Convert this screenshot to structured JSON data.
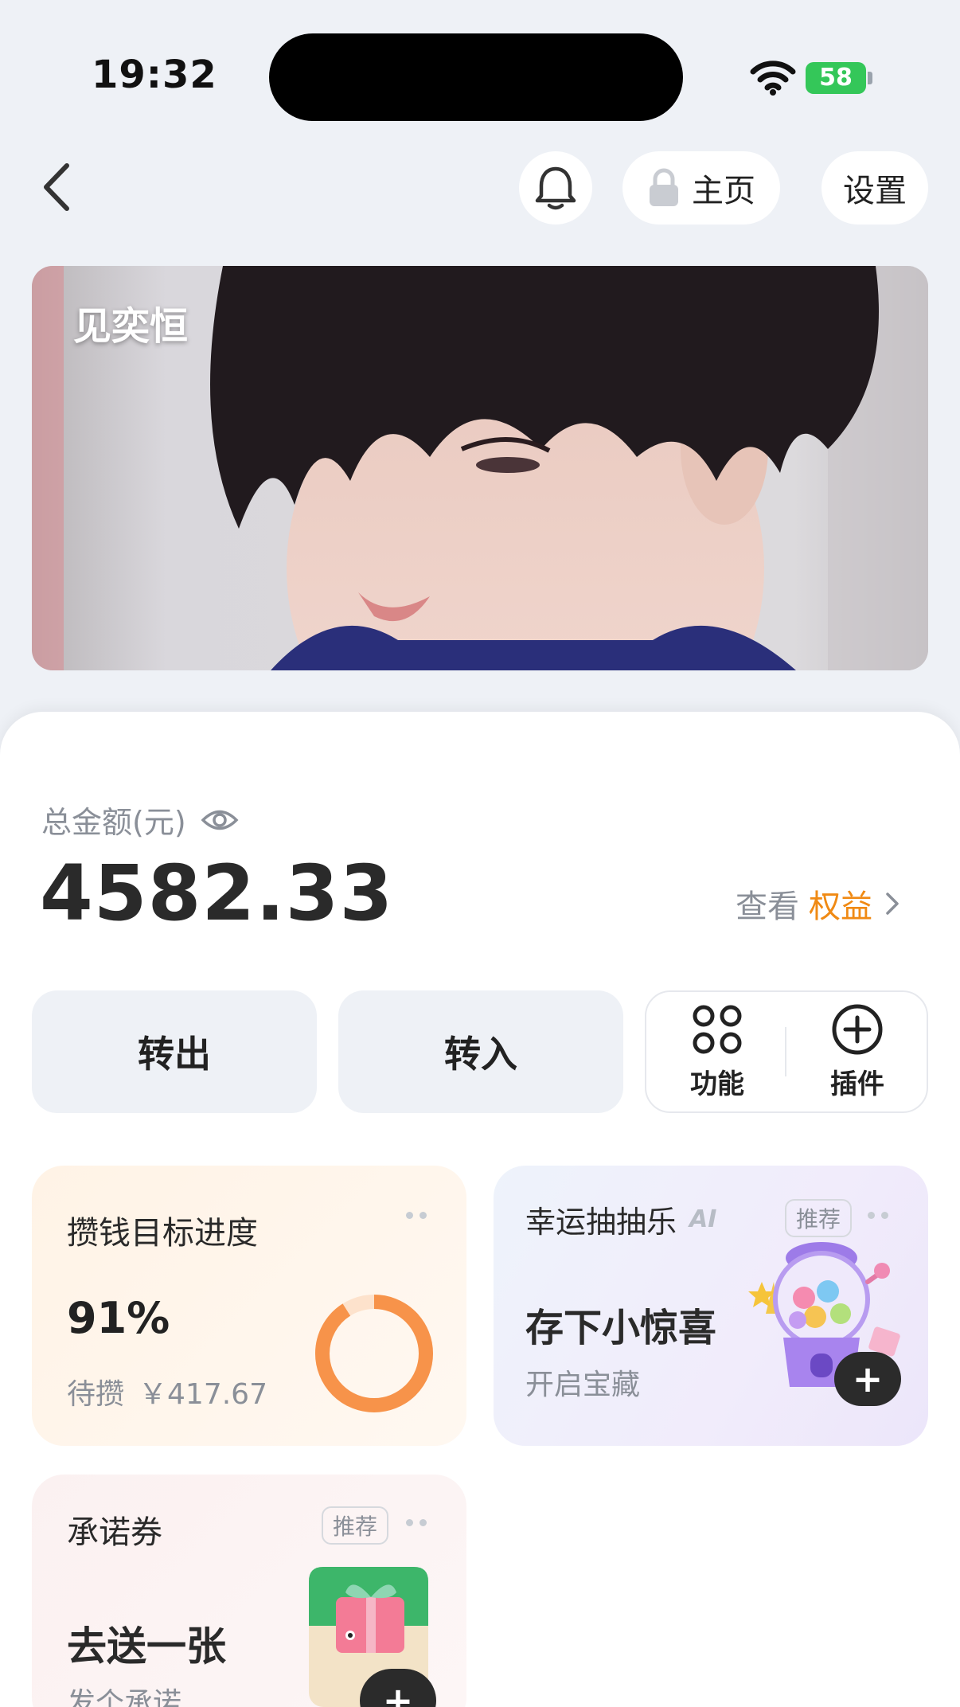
{
  "status_bar": {
    "time": "19:32",
    "battery": "58"
  },
  "nav": {
    "home_label": "主页",
    "settings_label": "设置"
  },
  "banner": {
    "title": "见奕恒"
  },
  "balance": {
    "label": "总金额(元)",
    "amount": "4582.33",
    "rights_prefix": "查看",
    "rights_accent": "权益"
  },
  "actions": {
    "transfer_out": "转出",
    "transfer_in": "转入",
    "functions": "功能",
    "plugins": "插件"
  },
  "goal_card": {
    "title": "攒钱目标进度",
    "percent": "91%",
    "progress": 0.91,
    "pending_label": "待攒",
    "pending_amount": "￥417.67"
  },
  "lucky_card": {
    "title": "幸运抽抽乐",
    "ai_badge": "AI",
    "tag": "推荐",
    "headline": "存下小惊喜",
    "sub": "开启宝藏"
  },
  "promise_card": {
    "title": "承诺券",
    "tag": "推荐",
    "headline": "去送一张",
    "sub": "发个承诺"
  },
  "colors": {
    "accent_orange": "#f08a14",
    "ring_orange": "#f7934a",
    "battery_green": "#34c759"
  }
}
